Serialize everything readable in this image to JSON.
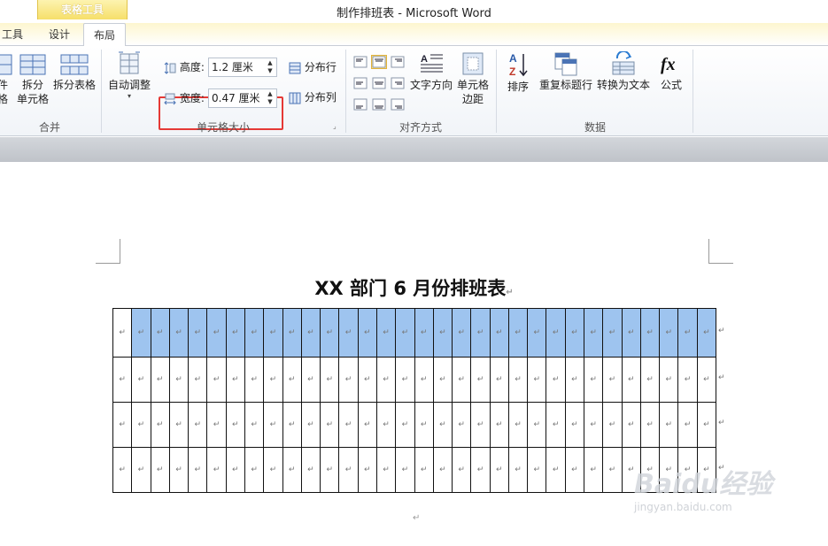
{
  "window": {
    "title": "制作排班表 - Microsoft Word"
  },
  "context_tab": {
    "label": "表格工具"
  },
  "tabs": [
    {
      "label": "工具"
    },
    {
      "label": "设计"
    },
    {
      "label": "布局",
      "active": true
    }
  ],
  "ribbon": {
    "merge_group": {
      "label": "合并",
      "partial_label": "件\n格",
      "split_cells": "拆分\n单元格",
      "split_table": "拆分表格"
    },
    "cell_size_group": {
      "label": "单元格大小",
      "autofit": "自动调整",
      "height_label": "高度:",
      "height_value": "1.2 厘米",
      "width_label": "宽度:",
      "width_value": "0.47 厘米",
      "distribute_rows": "分布行",
      "distribute_cols": "分布列"
    },
    "alignment_group": {
      "label": "对齐方式",
      "text_direction": "文字方向",
      "cell_margins": "单元格\n边距"
    },
    "data_group": {
      "label": "数据",
      "sort": "排序",
      "repeat_header": "重复标题行",
      "convert_to_text": "转换为文本",
      "formula": "公式"
    }
  },
  "document": {
    "title": "XX 部门 6 月份排班表",
    "paragraph_mark": "↵",
    "table": {
      "rows": 4,
      "cols": 32,
      "highlighted_row": 1
    }
  },
  "watermark": {
    "brand": "Baidu经验",
    "url": "jingyan.baidu.com"
  },
  "colors": {
    "highlight_row": "#9ec4ef",
    "context_tab": "#f6df6a",
    "annotation_box": "#e53935"
  }
}
